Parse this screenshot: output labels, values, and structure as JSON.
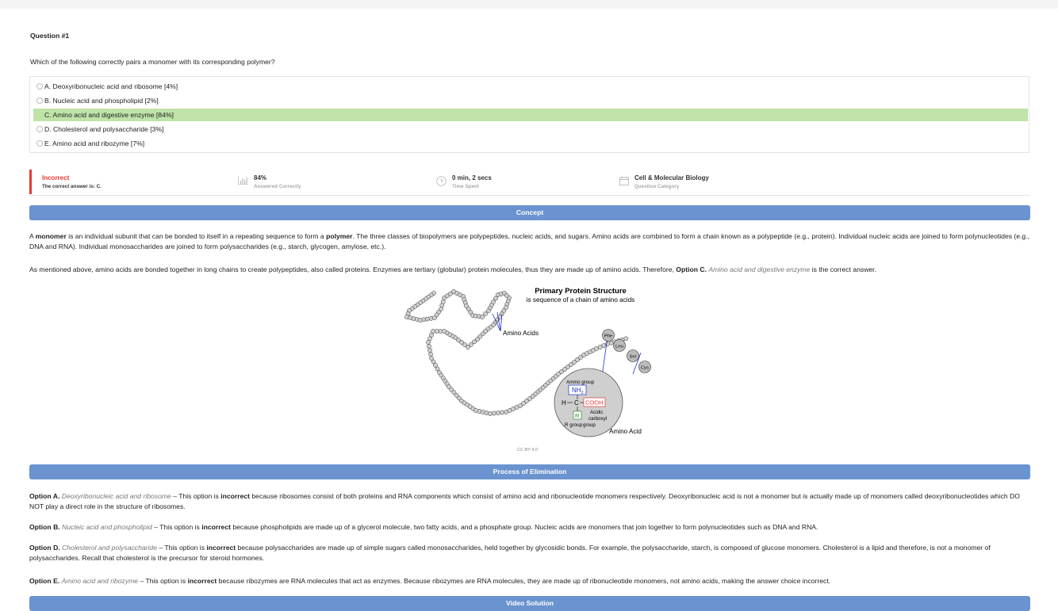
{
  "question": {
    "title": "Question #1",
    "text": "Which of the following correctly pairs a monomer with its corresponding polymer?",
    "options": [
      {
        "label": "A. Deoxyribonucleic acid and ribosome [4%]",
        "correct": false
      },
      {
        "label": "B. Nucleic acid and phospholipid [2%]",
        "correct": false
      },
      {
        "label": "C. Amino acid and digestive enzyme [84%]",
        "correct": true
      },
      {
        "label": "D. Cholesterol and polysaccharide [3%]",
        "correct": false
      },
      {
        "label": "E. Amino acid and ribozyme [7%]",
        "correct": false
      }
    ]
  },
  "stats": {
    "result": "Incorrect",
    "result_detail": "The correct answer is: C.",
    "percent": "84%",
    "percent_label": "Answered Correctly",
    "time": "0 min, 2 secs",
    "time_label": "Time Spent",
    "category": "Cell & Molecular Biology",
    "category_label": "Question Category"
  },
  "sections": {
    "concept": "Concept",
    "elimination": "Process of Elimination",
    "video": "Video Solution"
  },
  "concept": {
    "p1_a": "A ",
    "p1_b": "monomer",
    "p1_c": " is an individual subunit that can be bonded to itself in a repeating sequence to form a ",
    "p1_d": "polymer",
    "p1_e": ". The three classes of biopolymers are polypeptides, nucleic acids, and sugars. Amino acids are combined to form a chain known as a polypeptide (e.g., protein). Individual nucleic acids are joined to form polynucleotides (e.g., DNA and RNA). Individual monosaccharides are joined to form polysaccharides (e.g., starch, glycogen, amylose, etc.).",
    "p2_a": "As mentioned above, amino acids are bonded together in long chains to create polypeptides, also called proteins. Enzymes are tertiary (globular) protein molecules, thus they are made up of amino acids. Therefore, ",
    "p2_b": "Option C.",
    "p2_c": " ",
    "p2_d": "Amino acid and digestive enzyme",
    "p2_e": " is the correct answer."
  },
  "diagram": {
    "title": "Primary Protein Structure",
    "subtitle": "is sequence of a chain of amino acids",
    "amino_acids": "Amino Acids",
    "amino_group": "Amino group",
    "nh2": "NH",
    "nh2_sub": "2",
    "h": "H",
    "c": "C",
    "cooh": "COOH",
    "r": "R",
    "r_group": "R group",
    "acidic_1": "Acidic",
    "acidic_2": "carboxyl",
    "acidic_3": "group",
    "amino_acid": "Amino Acid",
    "phe": "Phe",
    "leu": "Leu",
    "ser": "Ser",
    "cys": "Cys",
    "caption": "CC BY 4.0"
  },
  "elimination": [
    {
      "option": "Option A.",
      "name": "Deoxyribonucleic acid and ribosome",
      "a": " – This option is ",
      "verdict": "incorrect",
      "b": " because ribosomes consist of both proteins and RNA components which consist of amino acid and ribonucleotide monomers respectively. Deoxyribonucleic acid is not a monomer but is actually made up of monomers called deoxyribonucleotides which DO NOT play a direct role in the structure of ribosomes."
    },
    {
      "option": "Option B.",
      "name": "Nucleic acid and phospholipid",
      "a": " – This option is ",
      "verdict": "incorrect",
      "b": " because phospholipids are made up of a glycerol molecule, two fatty acids, and a phosphate group. Nucleic acids are monomers that join together to form polynucleotides such as DNA and RNA."
    },
    {
      "option": "Option D.",
      "name": "Cholesterol and polysaccharide",
      "a": " – This option is ",
      "verdict": "incorrect",
      "b": " because polysaccharides are made up of simple sugars called monosaccharides, held together by glycosidic bonds. For example, the polysaccharide, starch, is composed of glucose monomers. Cholesterol is a lipid and therefore, is not a monomer of polysaccharides. Recall that cholesterol is the precursor for steroid hormones."
    },
    {
      "option": "Option E.",
      "name": "Amino acid and ribozyme",
      "a": " – This option is ",
      "verdict": "incorrect",
      "b": " because ribozymes are RNA molecules that act as enzymes. Because ribozymes are RNA molecules, they are made up of ribonucleotide monomers, not amino acids, making the answer choice incorrect."
    }
  ],
  "colors": {
    "band": "#6a93cf",
    "correct_bg": "#bfe3a8",
    "incorrect": "#e53935"
  },
  "icons": [
    "bar-chart-icon",
    "clock-icon",
    "calendar-icon"
  ]
}
